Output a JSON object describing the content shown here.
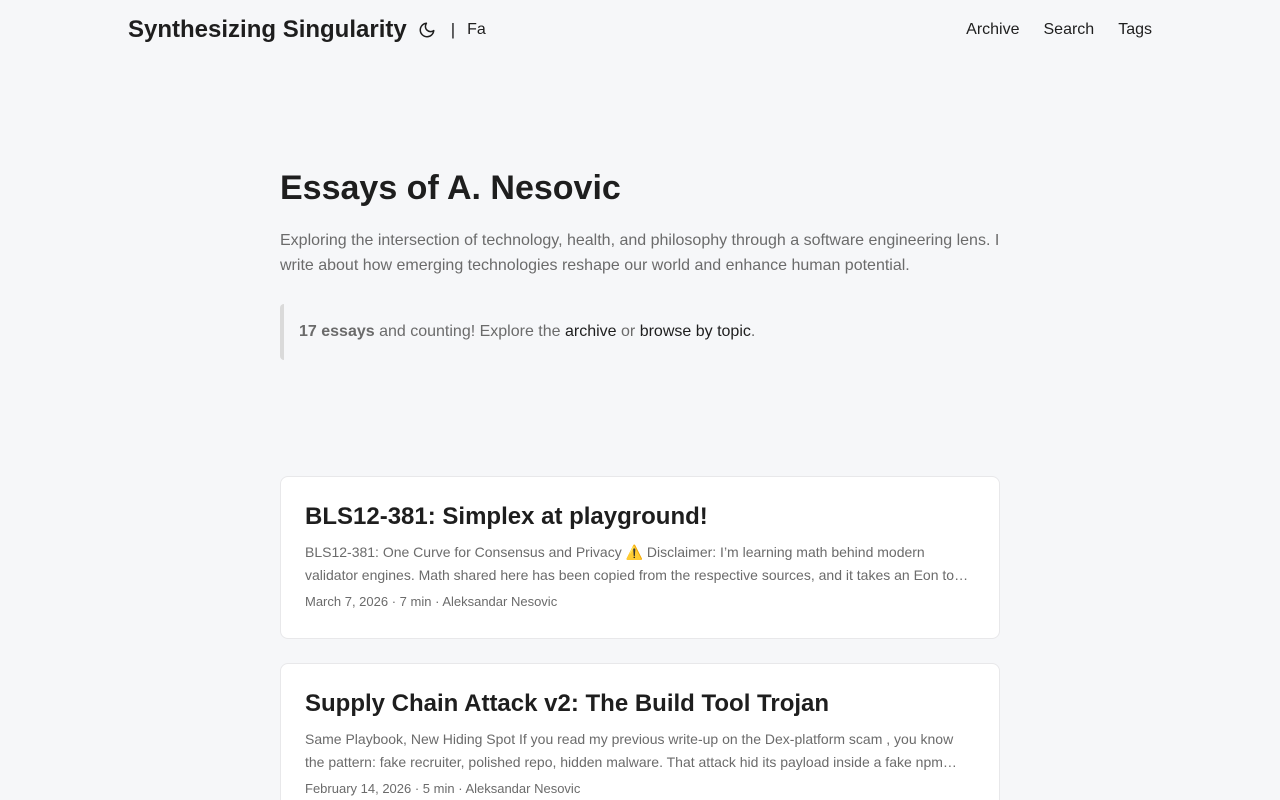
{
  "header": {
    "site_title": "Synthesizing Singularity",
    "separator": "|",
    "language": "Fa",
    "theme_icon": "moon-icon",
    "nav": [
      {
        "label": "Archive"
      },
      {
        "label": "Search"
      },
      {
        "label": "Tags"
      }
    ]
  },
  "hero": {
    "title": "Essays of A. Nesovic",
    "description": "Exploring the intersection of technology, health, and philosophy through a software engineering lens. I write about how emerging technologies reshape our world and enhance human potential.",
    "callout": {
      "count": "17 essays",
      "text1": " and counting! Explore the ",
      "archive_link": "archive",
      "text2": " or ",
      "topic_link": "browse by topic",
      "text3": "."
    }
  },
  "posts": [
    {
      "title": "BLS12-381: Simplex at playground!",
      "excerpt": "BLS12-381: One Curve for Consensus and Privacy ⚠️ Disclaimer: I’m learning math behind modern validator engines. Math shared here has been copied from the respective sources, and it takes an Eon to fully understand everything.",
      "date": "March 7, 2026",
      "read_time": "7 min",
      "author": "Aleksandar Nesovic"
    },
    {
      "title": "Supply Chain Attack v2: The Build Tool Trojan",
      "excerpt": "Same Playbook, New Hiding Spot If you read my previous write-up on the Dex-platform scam , you know the pattern: fake recruiter, polished repo, hidden malware. That attack hid its payload inside a fake npm package.",
      "date": "February 14, 2026",
      "read_time": "5 min",
      "author": "Aleksandar Nesovic"
    }
  ]
}
